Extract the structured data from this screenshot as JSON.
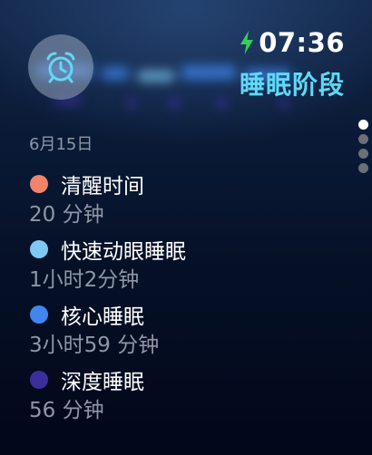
{
  "header": {
    "time": "07:36",
    "title": "睡眠阶段",
    "charging_icon": "lightning-bolt-icon",
    "alarm_icon": "alarm-clock-icon"
  },
  "date": "6月15日",
  "pagination": {
    "total": 4,
    "active_index": 0
  },
  "stages": [
    {
      "label": "清醒时间",
      "duration": "20 分钟",
      "color": "#f0846b"
    },
    {
      "label": "快速动眼睡眠",
      "duration": "1小时2分钟",
      "color": "#7ec9f2"
    },
    {
      "label": "核心睡眠",
      "duration": "3小时59 分钟",
      "color": "#3f86ee"
    },
    {
      "label": "深度睡眠",
      "duration": "56 分钟",
      "color": "#3b2f9c"
    }
  ],
  "colors": {
    "accent_title": "#5fd9f5",
    "charging_green": "#35d05a",
    "alarm_icon": "#5fd9f5",
    "secondary_text": "#8e97a6"
  }
}
